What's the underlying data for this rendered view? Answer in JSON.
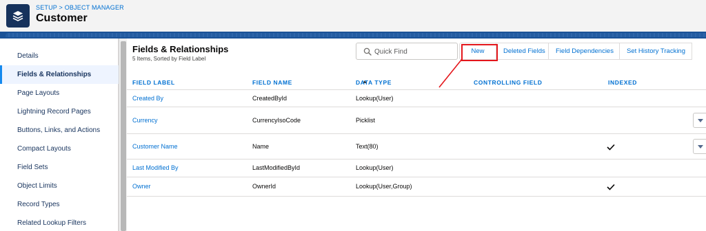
{
  "header": {
    "breadcrumb": "SETUP > OBJECT MANAGER",
    "title": "Customer",
    "icon": "layers-icon"
  },
  "sidebar": {
    "items": [
      {
        "label": "Details",
        "active": false
      },
      {
        "label": "Fields & Relationships",
        "active": true
      },
      {
        "label": "Page Layouts",
        "active": false
      },
      {
        "label": "Lightning Record Pages",
        "active": false
      },
      {
        "label": "Buttons, Links, and Actions",
        "active": false
      },
      {
        "label": "Compact Layouts",
        "active": false
      },
      {
        "label": "Field Sets",
        "active": false
      },
      {
        "label": "Object Limits",
        "active": false
      },
      {
        "label": "Record Types",
        "active": false
      },
      {
        "label": "Related Lookup Filters",
        "active": false
      }
    ]
  },
  "main": {
    "title": "Fields & Relationships",
    "subtitle": "5 Items, Sorted by Field Label",
    "search": {
      "placeholder": "Quick Find",
      "value": ""
    },
    "buttons": {
      "new": "New",
      "deleted_fields": "Deleted Fields",
      "field_dependencies": "Field Dependencies",
      "set_history_tracking": "Set History Tracking"
    }
  },
  "table": {
    "columns": [
      "FIELD LABEL",
      "FIELD NAME",
      "DATA TYPE",
      "CONTROLLING FIELD",
      "INDEXED"
    ],
    "rows": [
      {
        "label": "Created By",
        "name": "CreatedById",
        "type": "Lookup(User)",
        "controlling": "",
        "indexed": false,
        "menu": false
      },
      {
        "label": "Currency",
        "name": "CurrencyIsoCode",
        "type": "Picklist",
        "controlling": "",
        "indexed": false,
        "menu": true
      },
      {
        "label": "Customer Name",
        "name": "Name",
        "type": "Text(80)",
        "controlling": "",
        "indexed": true,
        "menu": true
      },
      {
        "label": "Last Modified By",
        "name": "LastModifiedById",
        "type": "Lookup(User)",
        "controlling": "",
        "indexed": false,
        "menu": false
      },
      {
        "label": "Owner",
        "name": "OwnerId",
        "type": "Lookup(User,Group)",
        "controlling": "",
        "indexed": true,
        "menu": false
      }
    ]
  },
  "colors": {
    "accent": "#0070d2",
    "header_icon_bg": "#16325c",
    "band": "#1b5297",
    "highlight": "#e4161b"
  }
}
